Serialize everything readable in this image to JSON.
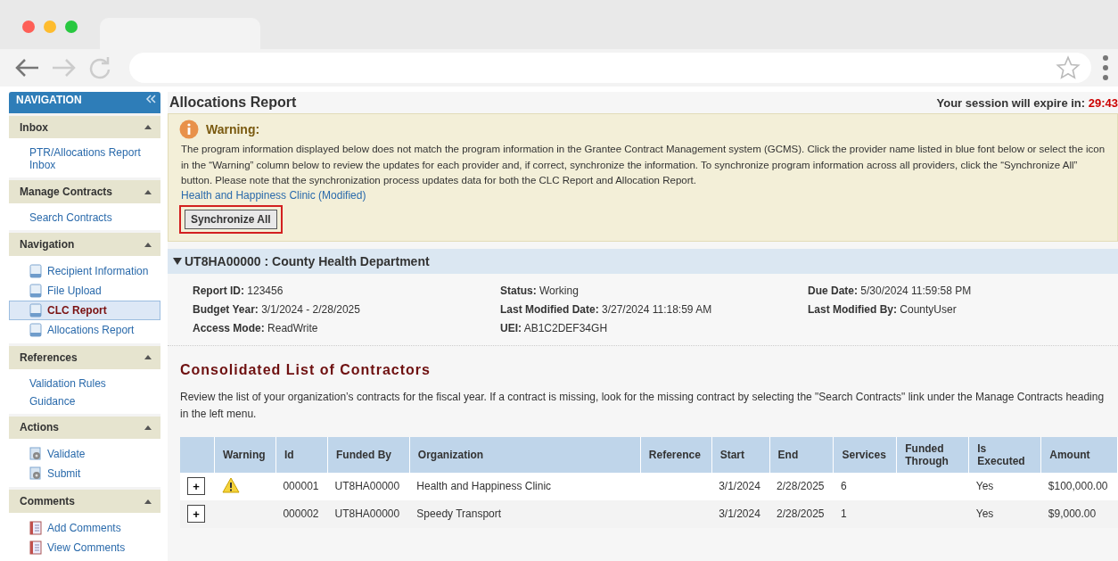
{
  "navigation": {
    "title": "NAVIGATION",
    "sections": [
      {
        "title": "Inbox",
        "items": [
          {
            "label": "PTR/Allocations Report Inbox",
            "kind": "link",
            "selected": false
          }
        ]
      },
      {
        "title": "Manage Contracts",
        "items": [
          {
            "label": "Search Contracts",
            "kind": "link",
            "selected": false
          }
        ]
      },
      {
        "title": "Navigation",
        "items": [
          {
            "label": "Recipient Information",
            "kind": "page",
            "selected": false
          },
          {
            "label": "File Upload",
            "kind": "page",
            "selected": false
          },
          {
            "label": "CLC Report",
            "kind": "page",
            "selected": true
          },
          {
            "label": "Allocations Report",
            "kind": "page",
            "selected": false
          }
        ]
      },
      {
        "title": "References",
        "items": [
          {
            "label": "Validation Rules",
            "kind": "link",
            "selected": false
          },
          {
            "label": "Guidance",
            "kind": "link",
            "selected": false
          }
        ]
      },
      {
        "title": "Actions",
        "items": [
          {
            "label": "Validate",
            "kind": "action",
            "selected": false
          },
          {
            "label": "Submit",
            "kind": "action",
            "selected": false
          }
        ]
      },
      {
        "title": "Comments",
        "items": [
          {
            "label": "Add Comments",
            "kind": "comment",
            "selected": false
          },
          {
            "label": "View Comments",
            "kind": "comment",
            "selected": false
          }
        ]
      }
    ]
  },
  "page_title": "Allocations Report",
  "session": {
    "label": "Your session will expire in:",
    "time": "29:43"
  },
  "warning": {
    "title": "Warning:",
    "message": "The program information displayed below does not match the program information in the Grantee Contract Management system (GCMS). Click the provider name listed in blue font below or select the icon in the “Warning” column below to review the updates for each provider and, if correct, synchronize the information. To synchronize program information across all providers, click the “Synchronize All” button. Please note that the synchronization process updates data for both the CLC Report and Allocation Report.",
    "link": "Health and Happiness Clinic (Modified)",
    "button": "Synchronize All"
  },
  "department": {
    "title": "UT8HA00000 : County Health Department",
    "fields": [
      {
        "label": "Report ID:",
        "value": "123456"
      },
      {
        "label": "Status:",
        "value": "Working"
      },
      {
        "label": "Due Date:",
        "value": "5/30/2024 11:59:58 PM"
      },
      {
        "label": "Budget Year:",
        "value": "3/1/2024 - 2/28/2025"
      },
      {
        "label": "Last Modified Date:",
        "value": "3/27/2024 11:18:59 AM"
      },
      {
        "label": "Last Modified By:",
        "value": "CountyUser"
      },
      {
        "label": "Access Mode:",
        "value": "ReadWrite"
      },
      {
        "label": "UEI:",
        "value": "AB1C2DEF34GH"
      }
    ]
  },
  "contractors": {
    "title": "Consolidated List of Contractors",
    "description": "Review the list of your organization’s contracts for the fiscal year. If a contract is missing, look for the missing contract by selecting the \"Search Contracts\" link under the Manage Contracts heading in the left menu.",
    "table": {
      "columns": [
        "Warning",
        "Id",
        "Funded By",
        "Organization",
        "Reference",
        "Start",
        "End",
        "Services",
        "Funded Through",
        "Is Executed",
        "Amount"
      ],
      "rows": [
        {
          "expand": "+",
          "warning": true,
          "id": "000001",
          "funded_by": "UT8HA00000",
          "organization": "Health and Happiness Clinic",
          "start": "3/1/2024",
          "end": "2/28/2025",
          "services": "6",
          "is_executed": "Yes",
          "amount": "$100,000.00"
        },
        {
          "expand": "+",
          "warning": false,
          "id": "000002",
          "funded_by": "UT8HA00000",
          "organization": "Speedy Transport",
          "start": "3/1/2024",
          "end": "2/28/2025",
          "services": "1",
          "is_executed": "Yes",
          "amount": "$9,000.00"
        }
      ]
    }
  }
}
